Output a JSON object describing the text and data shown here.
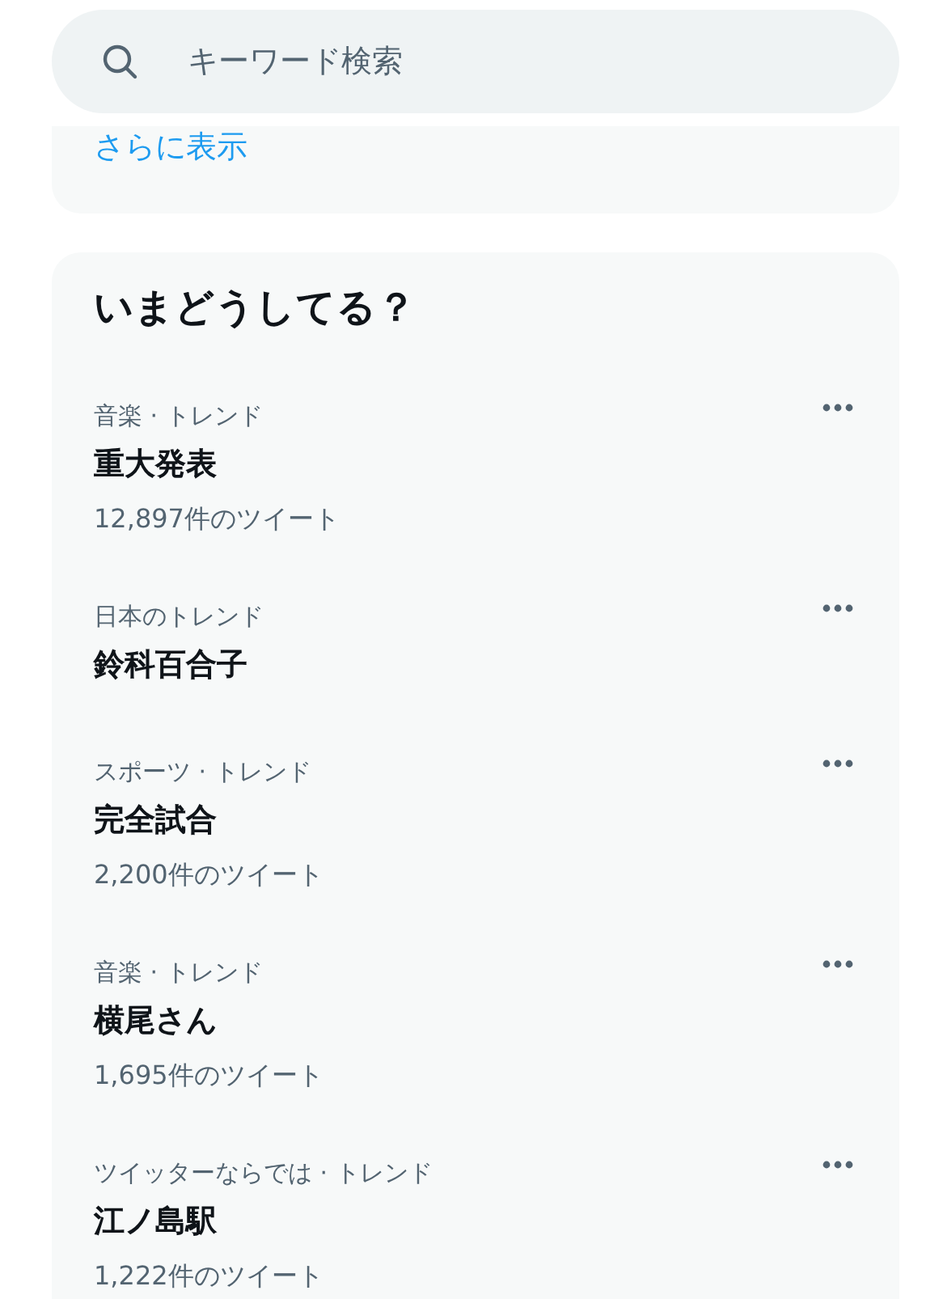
{
  "search": {
    "placeholder": "キーワード検索"
  },
  "more_link": "さらに表示",
  "trends": {
    "title": "いまどうしてる？",
    "items": [
      {
        "context": "音楽 · トレンド",
        "name": "重大発表",
        "count": "12,897件のツイート"
      },
      {
        "context": "日本のトレンド",
        "name": "鈴科百合子"
      },
      {
        "context": "スポーツ · トレンド",
        "name": "完全試合",
        "count": "2,200件のツイート"
      },
      {
        "context": "音楽 · トレンド",
        "name": "横尾さん",
        "count": "1,695件のツイート"
      },
      {
        "context": "ツイッターならでは · トレンド",
        "name": "江ノ島駅",
        "count": "1,222件のツイート"
      }
    ]
  }
}
